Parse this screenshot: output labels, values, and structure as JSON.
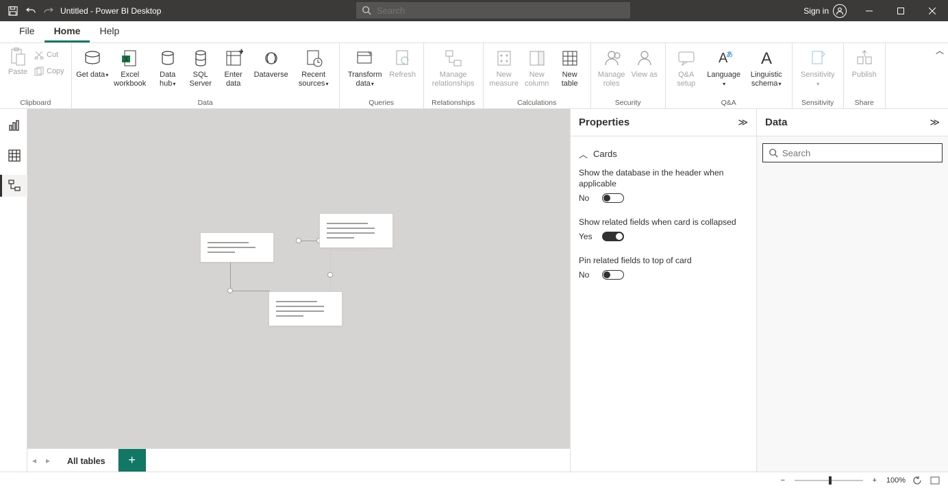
{
  "titlebar": {
    "app_title": "Untitled - Power BI Desktop",
    "search_placeholder": "Search",
    "signin": "Sign in"
  },
  "tabs": {
    "file": "File",
    "home": "Home",
    "help": "Help"
  },
  "ribbon": {
    "paste": "Paste",
    "cut": "Cut",
    "copy": "Copy",
    "get_data": "Get data",
    "excel": "Excel workbook",
    "data_hub": "Data hub",
    "sql": "SQL Server",
    "enter_data": "Enter data",
    "dataverse": "Dataverse",
    "recent": "Recent sources",
    "transform": "Transform data",
    "refresh": "Refresh",
    "manage_rel": "Manage relationships",
    "new_measure": "New measure",
    "new_column": "New column",
    "new_table": "New table",
    "manage_roles": "Manage roles",
    "view_as": "View as",
    "qa_setup": "Q&A setup",
    "language": "Language",
    "ling_schema": "Linguistic schema",
    "sensitivity": "Sensitivity",
    "publish": "Publish",
    "groups": {
      "clipboard": "Clipboard",
      "data": "Data",
      "queries": "Queries",
      "relationships": "Relationships",
      "calculations": "Calculations",
      "security": "Security",
      "qa": "Q&A",
      "sensitivity": "Sensitivity",
      "share": "Share"
    }
  },
  "properties": {
    "title": "Properties",
    "section": "Cards",
    "p1": {
      "label": "Show the database in the header when applicable",
      "state": "No"
    },
    "p2": {
      "label": "Show related fields when card is collapsed",
      "state": "Yes"
    },
    "p3": {
      "label": "Pin related fields to top of card",
      "state": "No"
    }
  },
  "data_pane": {
    "title": "Data",
    "search_placeholder": "Search"
  },
  "bottom": {
    "all_tables": "All tables"
  },
  "status": {
    "zoom": "100%"
  }
}
